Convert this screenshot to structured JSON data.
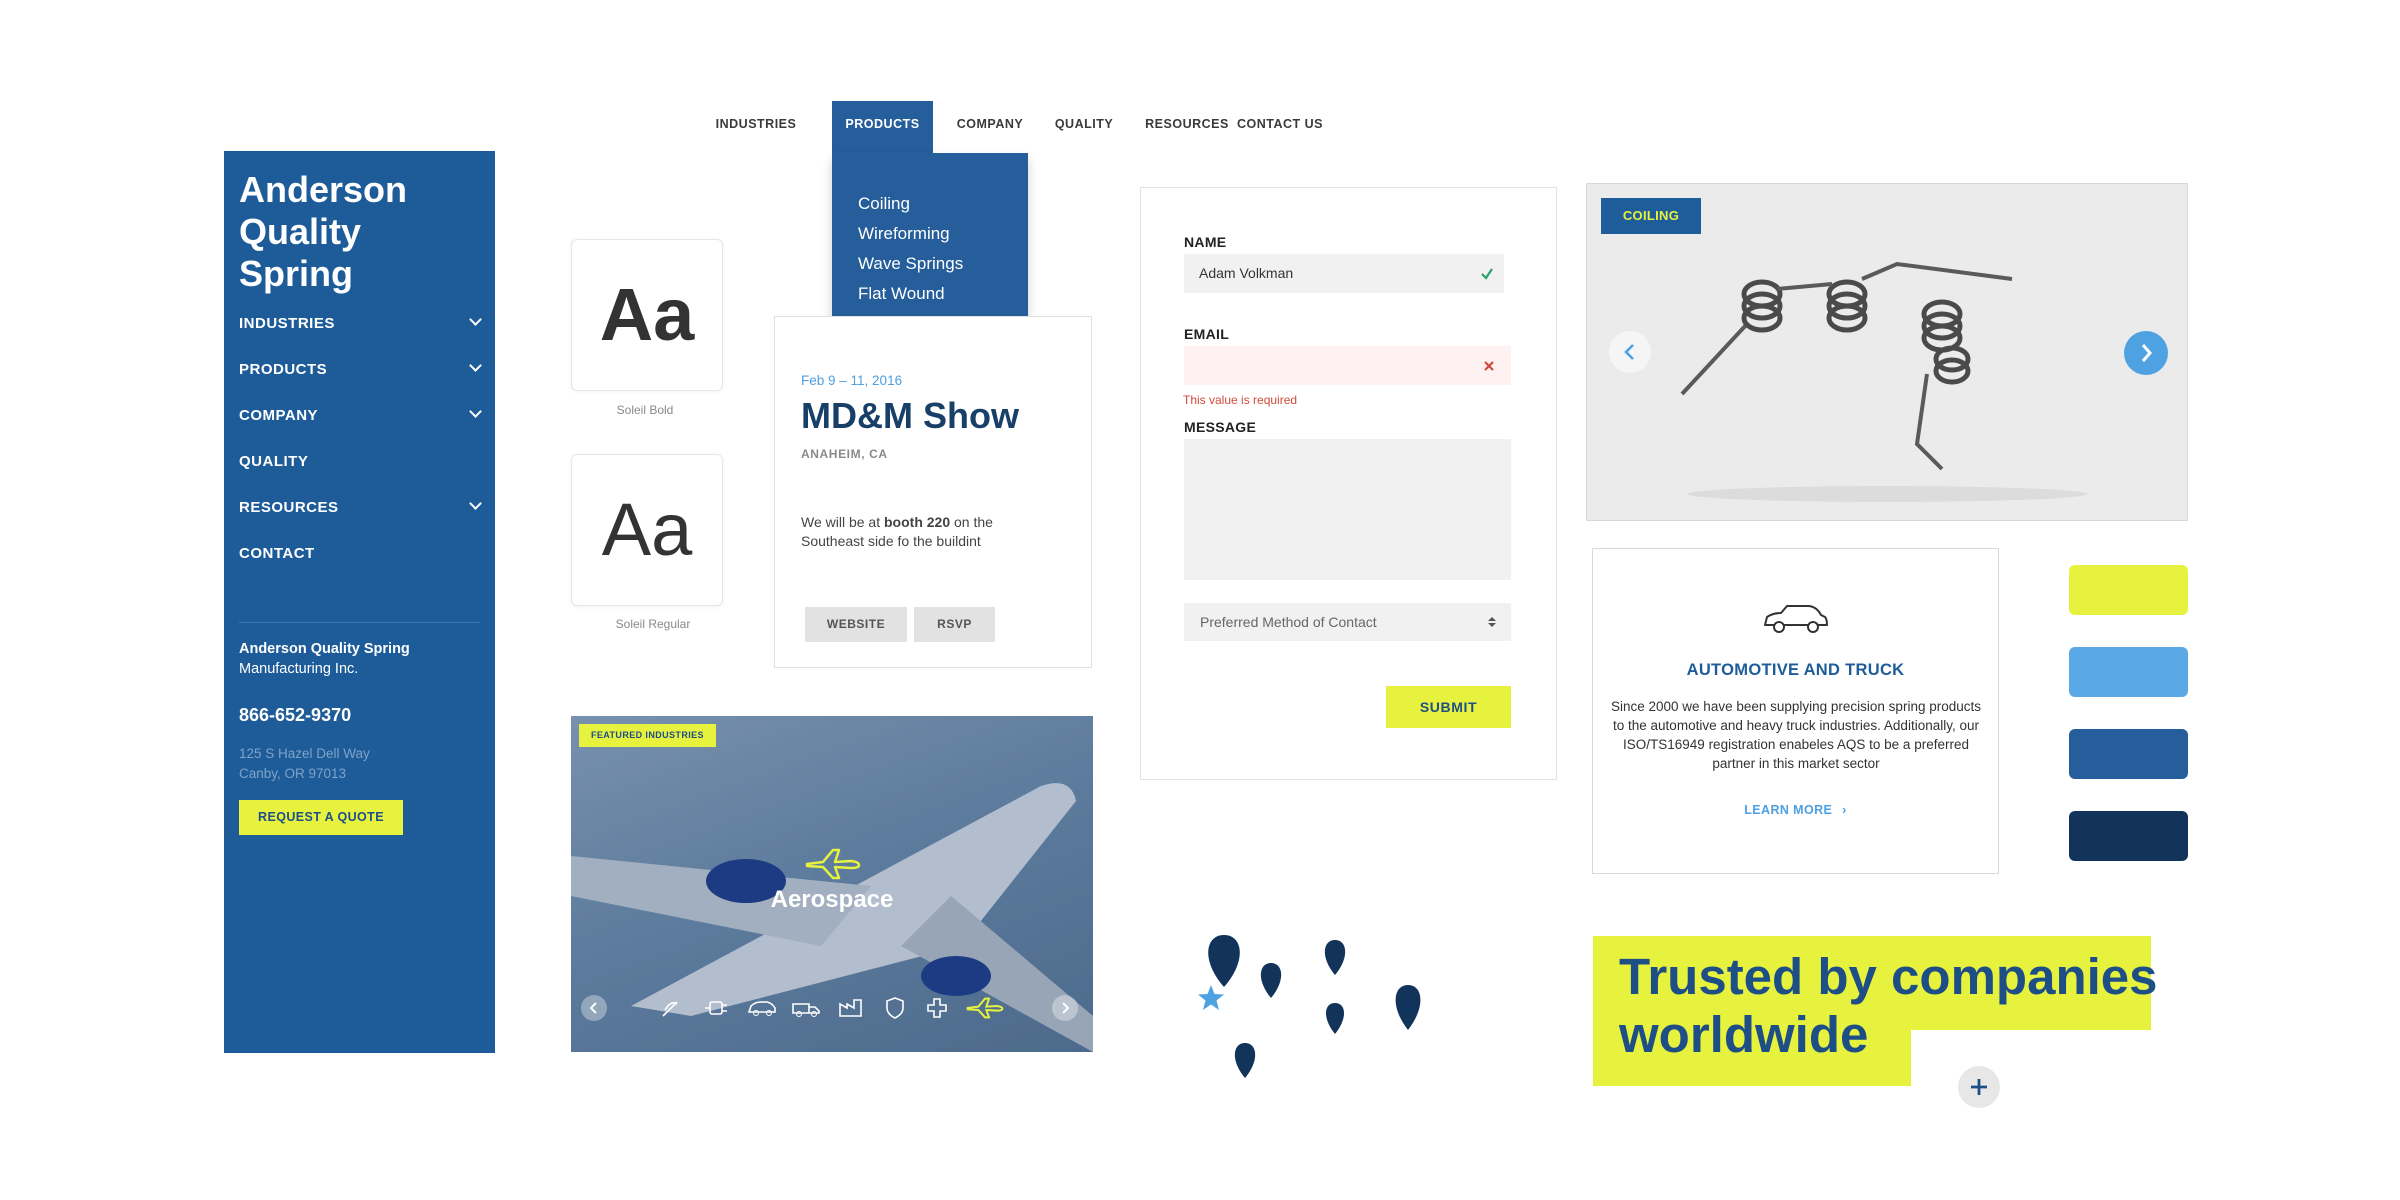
{
  "nav": {
    "items": [
      "INDUSTRIES",
      "PRODUCTS",
      "COMPANY",
      "QUALITY",
      "RESOURCES",
      "CONTACT US"
    ],
    "active": "PRODUCTS",
    "dropdown": [
      "Coiling",
      "Wireforming",
      "Wave Springs",
      "Flat Wound"
    ]
  },
  "sidebar": {
    "brand": "Anderson Quality Spring",
    "items": [
      {
        "label": "INDUSTRIES",
        "expandable": true
      },
      {
        "label": "PRODUCTS",
        "expandable": true
      },
      {
        "label": "COMPANY",
        "expandable": true
      },
      {
        "label": "QUALITY",
        "expandable": false
      },
      {
        "label": "RESOURCES",
        "expandable": true
      },
      {
        "label": "CONTACT",
        "expandable": false
      }
    ],
    "company_name": "Anderson Quality Spring",
    "company_sub": "Manufacturing Inc.",
    "phone": "866-652-9370",
    "address_1": "125 S Hazel Dell Way",
    "address_2": "Canby, OR 97013",
    "quote_button": "REQUEST A QUOTE"
  },
  "typography": {
    "sample": "Aa",
    "bold_caption": "Soleil Bold",
    "regular_caption": "Soleil Regular"
  },
  "event": {
    "date": "Feb 9 – 11, 2016",
    "title": "MD&M Show",
    "location": "ANAHEIM, CA",
    "desc_pre": "We will be at ",
    "desc_bold": "booth 220",
    "desc_post": " on the Southeast side fo the buildint",
    "website_button": "WEBSITE",
    "rsvp_button": "RSVP"
  },
  "aerospace": {
    "tag": "FEATURED INDUSTRIES",
    "title": "Aerospace",
    "icons": [
      "spring-icon",
      "plug-icon",
      "car-icon",
      "truck-icon",
      "factory-icon",
      "shield-icon",
      "medical-icon",
      "airplane-icon"
    ]
  },
  "form": {
    "name_label": "NAME",
    "name_value": "Adam Volkman",
    "email_label": "EMAIL",
    "email_value": "",
    "email_error": "This value is required",
    "message_label": "MESSAGE",
    "select_placeholder": "Preferred Method of Contact",
    "submit": "SUBMIT"
  },
  "slider": {
    "tag": "COILING"
  },
  "automotive": {
    "title": "AUTOMOTIVE AND TRUCK",
    "description": "Since 2000 we have been supplying precision spring products to the automotive and heavy truck industries. Additionally, our ISO/TS16949 registration enabeles AQS to be a preferred partner in this market sector",
    "link": "LEARN MORE"
  },
  "palette": [
    "#e6f23e",
    "#5aa9e6",
    "#255e9b",
    "#13345a"
  ],
  "trusted": {
    "line1": "Trusted by companies",
    "line2": "worldwide"
  }
}
